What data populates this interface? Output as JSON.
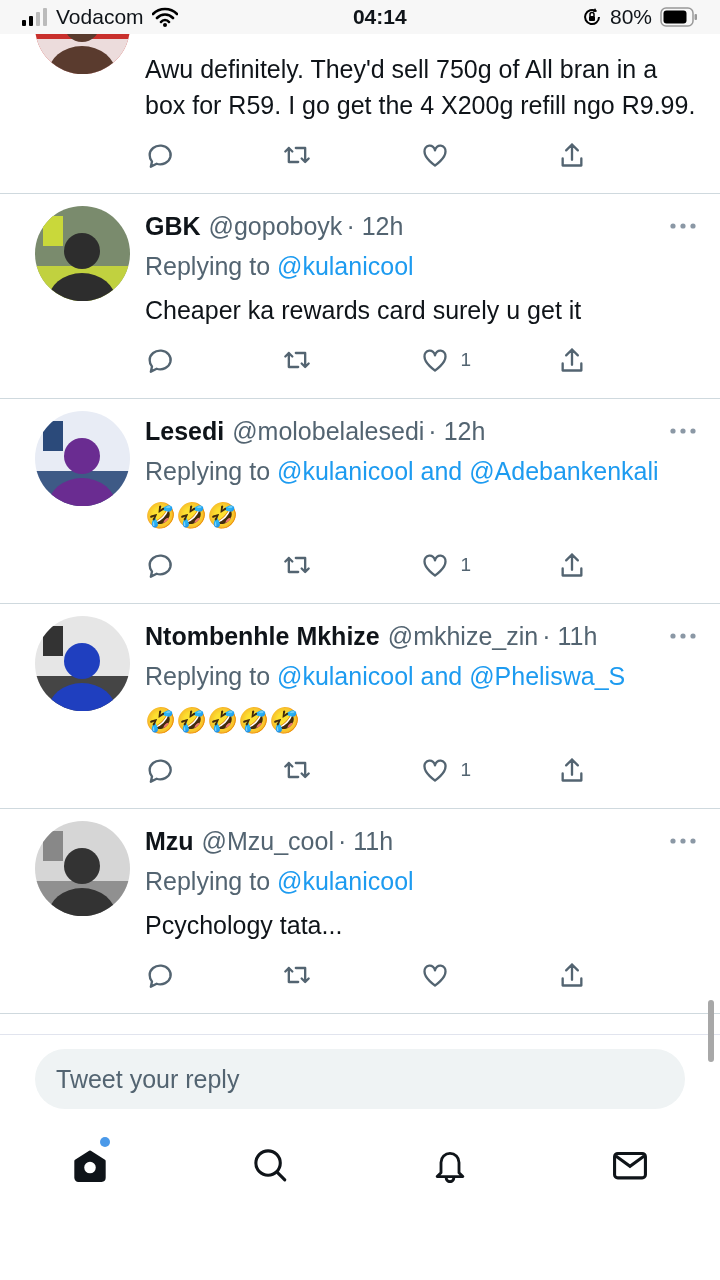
{
  "status_bar": {
    "carrier": "Vodacom",
    "time": "04:14",
    "battery": "80%"
  },
  "tweets": [
    {
      "kind": "cut",
      "text": "Awu definitely. They'd sell 750g of All bran in a box for R59. I go get the 4 X200g refill ngo R9.99."
    },
    {
      "kind": "full",
      "author": "GBK",
      "handle": "@gopoboyk",
      "time": "· 12h",
      "replying_to": {
        "label": "Replying to",
        "mentions": [
          "@kulanicool"
        ]
      },
      "text": "Cheaper ka rewards card surely u get it",
      "likes": "1"
    },
    {
      "kind": "full",
      "author": "Lesedi",
      "handle": "@molobelalesedi",
      "time": "· 12h",
      "replying_to": {
        "label": "Replying to",
        "mentions": [
          "@kulanicool",
          "@Adebankenkali"
        ],
        "joiner": "and"
      },
      "text": "🤣🤣🤣",
      "likes": "1"
    },
    {
      "kind": "full",
      "author": "Ntombenhle Mkhize",
      "handle": "@mkhize_zin",
      "time": "· 11h",
      "replying_to": {
        "label": "Replying to",
        "mentions": [
          "@kulanicool",
          "@Pheliswa_S"
        ],
        "joiner": "and"
      },
      "text": "🤣🤣🤣🤣🤣",
      "likes": "1"
    },
    {
      "kind": "full",
      "author": "Mzu",
      "handle": "@Mzu_cool",
      "time": "· 11h",
      "replying_to": {
        "label": "Replying to",
        "mentions": [
          "@kulanicool"
        ]
      },
      "text": "Pcychology tata..."
    }
  ],
  "reply_box": {
    "placeholder": "Tweet your reply"
  },
  "tabs": [
    {
      "kind": "home",
      "selected": true,
      "badge": true
    },
    {
      "kind": "search",
      "selected": false,
      "badge": false
    },
    {
      "kind": "notifications",
      "selected": false,
      "badge": false
    },
    {
      "kind": "messages",
      "selected": false,
      "badge": false
    }
  ]
}
